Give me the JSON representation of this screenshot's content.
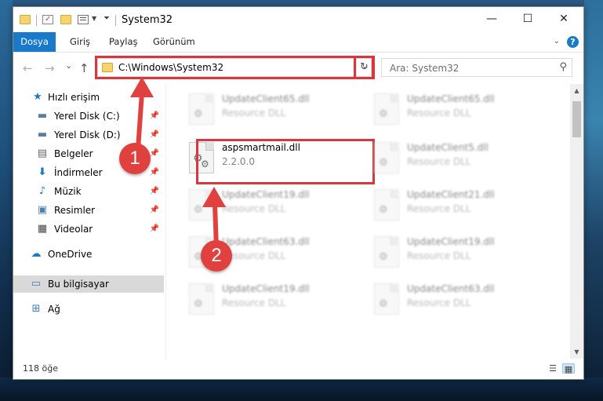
{
  "window": {
    "title": "System32",
    "controls": {
      "minimize": "—",
      "maximize": "☐",
      "close": "✕"
    }
  },
  "ribbon": {
    "tabs": [
      "Dosya",
      "Giriş",
      "Paylaş",
      "Görünüm"
    ],
    "help": "?"
  },
  "navbar": {
    "back": "←",
    "forward": "→",
    "recent": "⌄",
    "up": "↑",
    "address": "C:\\Windows\\System32",
    "search_placeholder": "Ara: System32"
  },
  "sidebar": {
    "items": [
      {
        "label": "Hızlı erişim",
        "icon": "star-icon",
        "pinned": false
      },
      {
        "label": "Yerel Disk (C:)",
        "icon": "drive-icon",
        "pinned": true
      },
      {
        "label": "Yerel Disk (D:)",
        "icon": "drive-icon",
        "pinned": true
      },
      {
        "label": "Belgeler",
        "icon": "documents-icon",
        "pinned": true
      },
      {
        "label": "İndirmeler",
        "icon": "download-icon",
        "pinned": true
      },
      {
        "label": "Müzik",
        "icon": "music-icon",
        "pinned": true
      },
      {
        "label": "Resimler",
        "icon": "pictures-icon",
        "pinned": true
      },
      {
        "label": "Videolar",
        "icon": "videos-icon",
        "pinned": true
      },
      {
        "label": "OneDrive",
        "icon": "cloud-icon",
        "pinned": false
      },
      {
        "label": "Bu bilgisayar",
        "icon": "computer-icon",
        "pinned": false
      },
      {
        "label": "Ağ",
        "icon": "network-icon",
        "pinned": false
      }
    ]
  },
  "files": [
    {
      "name": "UpdateClient65.dll",
      "sub": "Resource DLL"
    },
    {
      "name": "UpdateClient65.dll",
      "sub": "Resource DLL"
    },
    {
      "name": "aspsmartmail.dll",
      "sub": "2.2.0.0"
    },
    {
      "name": "UpdateClient5.dll",
      "sub": "Resource DLL"
    },
    {
      "name": "UpdateClient19.dll",
      "sub": "Resource DLL"
    },
    {
      "name": "UpdateClient21.dll",
      "sub": "Resource DLL"
    },
    {
      "name": "UpdateClient63.dll",
      "sub": "Resource DLL"
    },
    {
      "name": "UpdateClient19.dll",
      "sub": "Resource DLL"
    },
    {
      "name": "UpdateClient19.dll",
      "sub": "Resource DLL"
    },
    {
      "name": "UpdateClient63.dll",
      "sub": "Resource DLL"
    }
  ],
  "status": {
    "count": "118 öğe"
  },
  "annotations": {
    "step1": "1",
    "step2": "2"
  },
  "colors": {
    "accent": "#1979ca",
    "highlight": "#d9363e",
    "badge": "#e0413f"
  }
}
